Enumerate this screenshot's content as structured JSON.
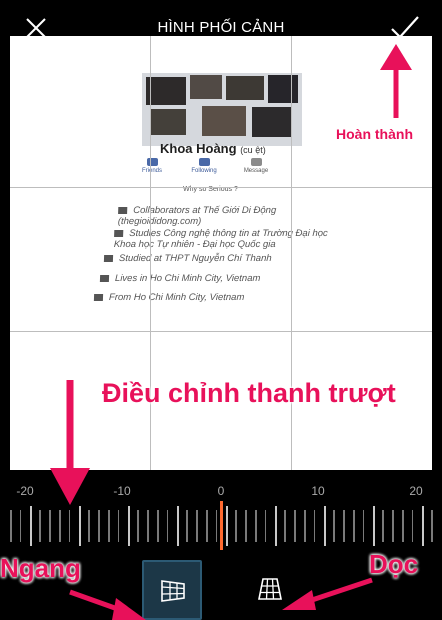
{
  "header": {
    "title": "HÌNH PHỐI CẢNH"
  },
  "profile": {
    "name": "Khoa Hoàng",
    "name_suffix": "(cu ệt)",
    "tabs": [
      "Friends",
      "Following",
      "Message"
    ],
    "tagline": "Why so Serious ?",
    "info": [
      "Collaborators at Thế Giới Di Động (thegioididong.com)",
      "Studies Công nghệ thông tin at Trường Đại học Khoa học Tự nhiên - Đại học Quốc gia",
      "Studied at THPT Nguyễn Chí Thanh",
      "Lives in Ho Chi Minh City, Vietnam",
      "From Ho Chi Minh City, Vietnam"
    ]
  },
  "annotations": {
    "done": "Hoàn thành",
    "slider": "Điều chỉnh thanh trượt",
    "horizontal": "Ngang",
    "vertical": "Dọc"
  },
  "ruler": {
    "labels": [
      "-20",
      "-10",
      "0",
      "10",
      "20"
    ],
    "value": 0
  },
  "modes": {
    "selected": "horizontal"
  },
  "icons": {
    "close": "close-icon",
    "done": "checkmark-icon",
    "horizontal": "horizontal-perspective-icon",
    "vertical": "vertical-perspective-icon"
  },
  "colors": {
    "annotation": "#e8115a",
    "ruler_indicator": "#ff6a2f",
    "active_mode": "#1c3747"
  }
}
